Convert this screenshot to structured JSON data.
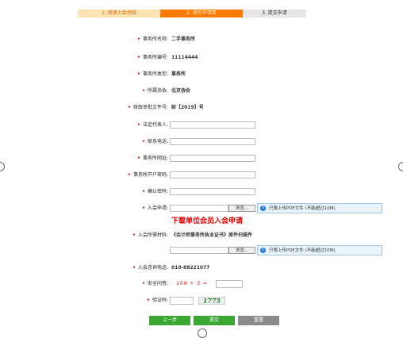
{
  "steps": [
    {
      "label": "1.  阅读入会须知"
    },
    {
      "label": "2.  填写申请单"
    },
    {
      "label": "3.  提交申请"
    }
  ],
  "form": {
    "firm_name": {
      "label": "事务所名称:",
      "value": "二手事务所"
    },
    "firm_number": {
      "label": "事务所编号:",
      "value": "11114444"
    },
    "firm_type": {
      "label": "事务所类型:",
      "value": "事务所"
    },
    "association": {
      "label": "所属协会:",
      "value": "北京协会"
    },
    "approval_no": {
      "label": "财政审批文件号:",
      "value": "财【2019】号"
    },
    "legal_rep": {
      "label": "法定代表人:"
    },
    "phone": {
      "label": "联系电话:"
    },
    "website": {
      "label": "事务所网址:"
    },
    "password": {
      "label": "事务所开户密码:"
    },
    "confirm_password": {
      "label": "确认密码:"
    },
    "application": {
      "label": "入会申请:"
    },
    "attachment": {
      "label": "入会所需材料:",
      "value": "《会计师事务所执业证书》原件扫描件"
    },
    "consult_phone": {
      "label": "入会咨询电话:",
      "value": "010-88221077"
    },
    "security_q": {
      "label": "安全问答:",
      "question": "100 + 3 ="
    },
    "captcha": {
      "label": "验证码:",
      "image_text": "1775"
    }
  },
  "browse_label": "浏览...",
  "upload_hint": "只限上传PDF文件 (不能超过10M)",
  "download_link": "下载单位会员入会申请",
  "buttons": {
    "prev": "上一步",
    "submit": "提交",
    "reset": "重置"
  }
}
